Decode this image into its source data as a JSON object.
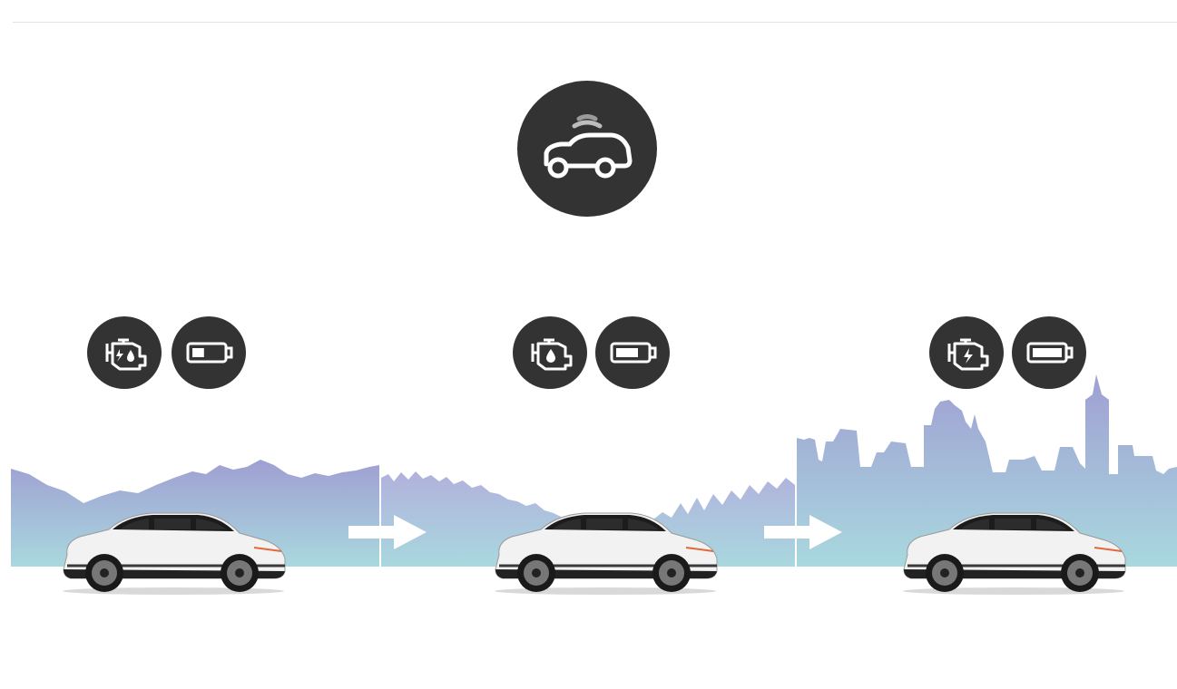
{
  "figure": {
    "stages": [
      {
        "id": "stage-1",
        "engine_indicator": "engine-electric-fuel-icon",
        "battery_level": 0.4,
        "backdrop": "mountains"
      },
      {
        "id": "stage-2",
        "engine_indicator": "engine-fuel-icon",
        "battery_level": 0.75,
        "backdrop": "suburbs"
      },
      {
        "id": "stage-3",
        "engine_indicator": "engine-electric-icon",
        "battery_level": 1.0,
        "backdrop": "city"
      }
    ],
    "top_badge_icon": "connected-car-icon",
    "colors": {
      "badge": "#333333",
      "sky_top": "#9f9fd2",
      "sky_bottom": "#a9d8df",
      "car_body": "#f2f2f2",
      "car_roof": "#1c1c1c"
    }
  }
}
